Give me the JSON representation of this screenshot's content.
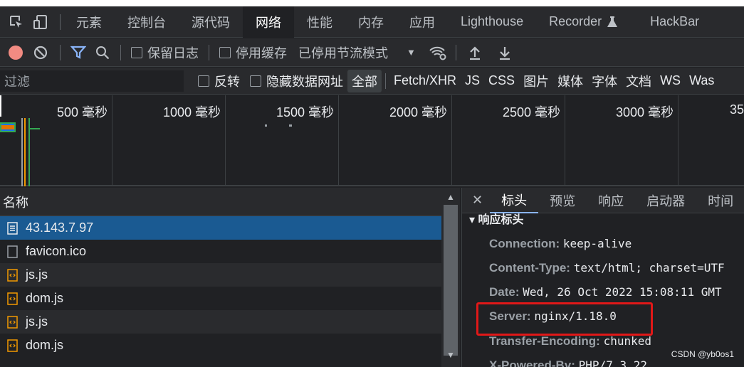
{
  "tabbar": {
    "tabs": [
      "元素",
      "控制台",
      "源代码",
      "网络",
      "性能",
      "内存",
      "应用",
      "Lighthouse",
      "Recorder",
      "HackBar"
    ]
  },
  "toolbar": {
    "preserve_log": "保留日志",
    "disable_cache": "停用缓存",
    "throttling": "已停用节流模式"
  },
  "filterbar": {
    "placeholder": "过滤",
    "invert": "反转",
    "hide_data_urls": "隐藏数据网址",
    "types": [
      "全部",
      "Fetch/XHR",
      "JS",
      "CSS",
      "图片",
      "媒体",
      "字体",
      "文档",
      "WS",
      "Was"
    ]
  },
  "timeline": {
    "ticks": [
      "500 毫秒",
      "1000 毫秒",
      "1500 毫秒",
      "2000 毫秒",
      "2500 毫秒",
      "3000 毫秒",
      "35"
    ]
  },
  "list": {
    "header": "名称",
    "rows": [
      {
        "name": "43.143.7.97",
        "type": "doc"
      },
      {
        "name": "favicon.ico",
        "type": "blank"
      },
      {
        "name": "js.js",
        "type": "js"
      },
      {
        "name": "dom.js",
        "type": "js"
      },
      {
        "name": "js.js",
        "type": "js"
      },
      {
        "name": "dom.js",
        "type": "js"
      }
    ]
  },
  "detail": {
    "tabs": [
      "标头",
      "预览",
      "响应",
      "启动器",
      "时间"
    ],
    "section_title": "▾ 响应标头",
    "headers": [
      {
        "key": "Connection:",
        "value": "keep-alive"
      },
      {
        "key": "Content-Type:",
        "value": "text/html; charset=UTF"
      },
      {
        "key": "Date:",
        "value": "Wed, 26 Oct 2022 15:08:11 GMT"
      },
      {
        "key": "Server:",
        "value": "nginx/1.18.0"
      },
      {
        "key": "Transfer-Encoding:",
        "value": "chunked"
      },
      {
        "key": "X-Powered-By:",
        "value": "PHP/7.3.22"
      }
    ]
  },
  "watermark": "CSDN @yb0os1",
  "colors": {
    "record": "#f28b82",
    "accent": "#8ab4f8",
    "selected_row": "#1a5a92",
    "highlight_box": "#e01818"
  }
}
